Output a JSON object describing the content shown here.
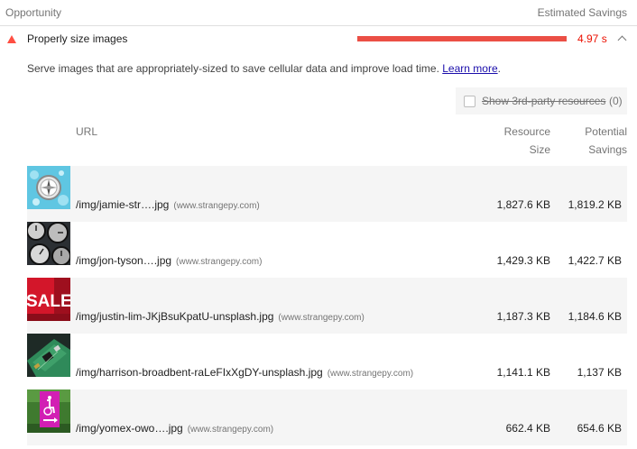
{
  "header": {
    "opportunity": "Opportunity",
    "estimated_savings": "Estimated Savings"
  },
  "audit": {
    "title": "Properly size images",
    "savings": "4.97 s",
    "description": "Serve images that are appropriately-sized to save cellular data and improve load time.",
    "learn_more": "Learn more",
    "description_end": ".",
    "third_party_label": "Show 3rd-party resources",
    "third_party_count": "(0)",
    "colors": {
      "warn": "#ff4e42",
      "bar": "#eb4f45",
      "savings_text": "#eb0f00"
    }
  },
  "table": {
    "columns": {
      "url": "URL",
      "size_line1": "Resource",
      "size_line2": "Size",
      "savings_line1": "Potential",
      "savings_line2": "Savings"
    },
    "rows": [
      {
        "url": "/img/jamie-str….jpg",
        "host": "(www.strangepy.com)",
        "size": "1,827.6 KB",
        "savings": "1,819.2 KB",
        "thumb": "compass"
      },
      {
        "url": "/img/jon-tyson….jpg",
        "host": "(www.strangepy.com)",
        "size": "1,429.3 KB",
        "savings": "1,422.7 KB",
        "thumb": "clocks"
      },
      {
        "url": "/img/justin-lim-JKjBsuKpatU-unsplash.jpg",
        "host": "(www.strangepy.com)",
        "size": "1,187.3 KB",
        "savings": "1,184.6 KB",
        "thumb": "sale-sign",
        "thumb_text": "SALE"
      },
      {
        "url": "/img/harrison-broadbent-raLeFIxXgDY-unsplash.jpg",
        "host": "(www.strangepy.com)",
        "size": "1,141.1 KB",
        "savings": "1,137 KB",
        "thumb": "circuit-board"
      },
      {
        "url": "/img/yomex-owo….jpg",
        "host": "(www.strangepy.com)",
        "size": "662.4 KB",
        "savings": "654.6 KB",
        "thumb": "pink-sign"
      }
    ]
  }
}
